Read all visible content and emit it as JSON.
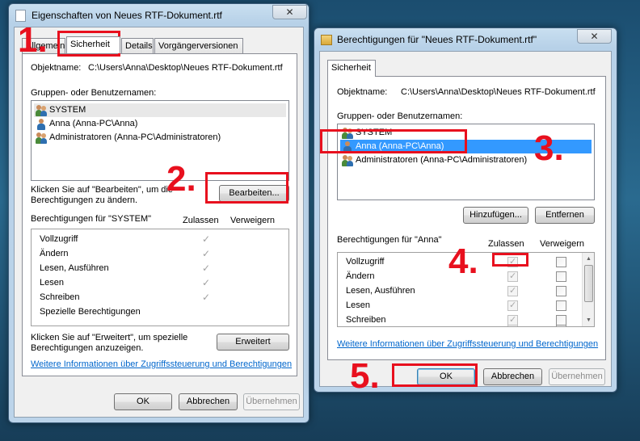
{
  "colors": {
    "annotation": "#e8101e",
    "selection": "#3399ff",
    "link": "#0066cc"
  },
  "left_dialog": {
    "title": "Eigenschaften von Neues RTF-Dokument.rtf",
    "close_glyph": "✕",
    "tabs": [
      "Allgemein",
      "Sicherheit",
      "Details",
      "Vorgängerversionen"
    ],
    "object_label": "Objektname:",
    "object_value": "C:\\Users\\Anna\\Desktop\\Neues RTF-Dokument.rtf",
    "groups_label": "Gruppen- oder Benutzernamen:",
    "groups": [
      {
        "name": "SYSTEM",
        "icon": "group-icon"
      },
      {
        "name": "Anna (Anna-PC\\Anna)",
        "icon": "user-icon"
      },
      {
        "name": "Administratoren (Anna-PC\\Administratoren)",
        "icon": "group-icon"
      }
    ],
    "edit_hint_1": "Klicken Sie auf \"Bearbeiten\", um die",
    "edit_hint_2": "Berechtigungen zu ändern.",
    "edit_button": "Bearbeiten...",
    "perm_label": "Berechtigungen für \"SYSTEM\"",
    "col_allow": "Zulassen",
    "col_deny": "Verweigern",
    "permissions": [
      {
        "name": "Vollzugriff",
        "allow": true
      },
      {
        "name": "Ändern",
        "allow": true
      },
      {
        "name": "Lesen, Ausführen",
        "allow": true
      },
      {
        "name": "Lesen",
        "allow": true
      },
      {
        "name": "Schreiben",
        "allow": true
      },
      {
        "name": "Spezielle Berechtigungen",
        "allow": false
      }
    ],
    "adv_hint_1": "Klicken Sie auf \"Erweitert\", um spezielle",
    "adv_hint_2": "Berechtigungen anzuzeigen.",
    "advanced_button": "Erweitert",
    "info_link": "Weitere Informationen über Zugriffssteuerung und Berechtigungen",
    "ok": "OK",
    "cancel": "Abbrechen",
    "apply": "Übernehmen"
  },
  "right_dialog": {
    "title": "Berechtigungen für \"Neues RTF-Dokument.rtf\"",
    "close_glyph": "✕",
    "tab": "Sicherheit",
    "object_label": "Objektname:",
    "object_value": "C:\\Users\\Anna\\Desktop\\Neues RTF-Dokument.rtf",
    "groups_label": "Gruppen- oder Benutzernamen:",
    "groups": [
      {
        "name": "SYSTEM",
        "icon": "group-icon"
      },
      {
        "name": "Anna (Anna-PC\\Anna)",
        "icon": "user-icon",
        "selected": true
      },
      {
        "name": "Administratoren (Anna-PC\\Administratoren)",
        "icon": "group-icon"
      }
    ],
    "add_button": "Hinzufügen...",
    "remove_button": "Entfernen",
    "perm_label": "Berechtigungen für \"Anna\"",
    "col_allow": "Zulassen",
    "col_deny": "Verweigern",
    "permissions": [
      {
        "name": "Vollzugriff"
      },
      {
        "name": "Ändern"
      },
      {
        "name": "Lesen, Ausführen"
      },
      {
        "name": "Lesen"
      },
      {
        "name": "Schreiben"
      }
    ],
    "info_link": "Weitere Informationen über Zugriffssteuerung und Berechtigungen",
    "ok": "OK",
    "cancel": "Abbrechen",
    "apply": "Übernehmen"
  },
  "annotations": [
    "1.",
    "2.",
    "3.",
    "4.",
    "5."
  ]
}
